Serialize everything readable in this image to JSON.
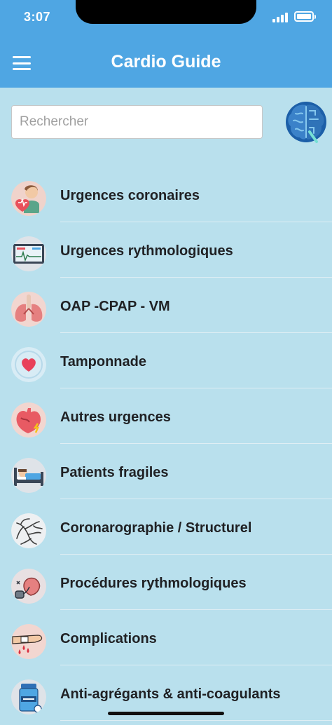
{
  "status_bar": {
    "time": "3:07"
  },
  "header": {
    "title": "Cardio Guide"
  },
  "search": {
    "placeholder": "Rechercher",
    "value": ""
  },
  "list": {
    "items": [
      {
        "label": "Urgences coronaires",
        "icon": "chest-pain-icon"
      },
      {
        "label": "Urgences rythmologiques",
        "icon": "ecg-monitor-icon"
      },
      {
        "label": "OAP -CPAP - VM",
        "icon": "lungs-icon"
      },
      {
        "label": "Tamponnade",
        "icon": "heart-icon"
      },
      {
        "label": "Autres urgences",
        "icon": "heart-alert-icon"
      },
      {
        "label": "Patients fragiles",
        "icon": "patient-bed-icon"
      },
      {
        "label": "Coronarographie / Structurel",
        "icon": "angiography-icon"
      },
      {
        "label": "Procédures rythmologiques",
        "icon": "pacemaker-icon"
      },
      {
        "label": "Complications",
        "icon": "bleeding-arm-icon"
      },
      {
        "label": "Anti-agrégants & anti-coagulants",
        "icon": "aspirin-bottle-icon"
      }
    ]
  },
  "colors": {
    "header": "#4fa6e3",
    "background": "#b9e0ed",
    "text": "#202124"
  }
}
